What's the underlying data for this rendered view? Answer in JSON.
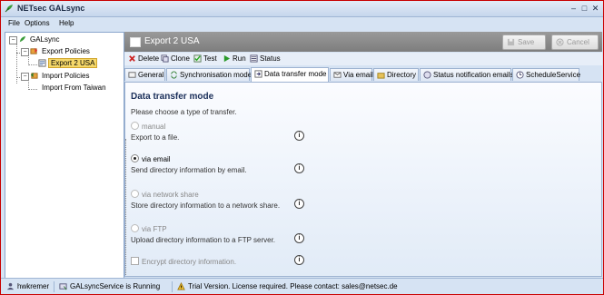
{
  "window": {
    "title": "NETsec GALsync"
  },
  "menu": [
    "File",
    "Options",
    "Help"
  ],
  "tree": {
    "root": "GALsync",
    "export_policies": "Export Policies",
    "export_item": "Export 2 USA",
    "import_policies": "Import Policies",
    "import_item": "Import From Taiwan"
  },
  "header": {
    "title": "Export 2 USA",
    "save_label": "Save",
    "cancel_label": "Cancel"
  },
  "toolbar": {
    "delete": "Delete",
    "clone": "Clone",
    "test": "Test",
    "run": "Run",
    "status": "Status"
  },
  "tabs": [
    "General",
    "Synchronisation mode",
    "Data transfer mode",
    "Via email",
    "Directory",
    "Status notification emails",
    "ScheduleService"
  ],
  "active_tab": "Data transfer mode",
  "panel": {
    "title": "Data transfer mode",
    "description": "Please choose a type of transfer.",
    "options": [
      {
        "name": "manual",
        "desc": "Export to a file.",
        "selected": false
      },
      {
        "name": "via email",
        "desc": "Send directory information by email.",
        "selected": true
      },
      {
        "name": "via network share",
        "desc": "Store directory information to a network share.",
        "selected": false
      },
      {
        "name": "via FTP",
        "desc": "Upload directory information to a FTP server.",
        "selected": false
      }
    ],
    "encrypt_label": "Encrypt directory information.",
    "encrypt_checked": false,
    "info_glyph": "i"
  },
  "status": {
    "user": "hwkremer",
    "service": "GALsyncService is Running",
    "license": "Trial Version. License required. Please contact: sales@netsec.de"
  },
  "colors": {
    "accent": "#1b2f5a",
    "selection": "#f5d86a",
    "header_bg": "#8a8a8a",
    "border": "#c80000"
  }
}
